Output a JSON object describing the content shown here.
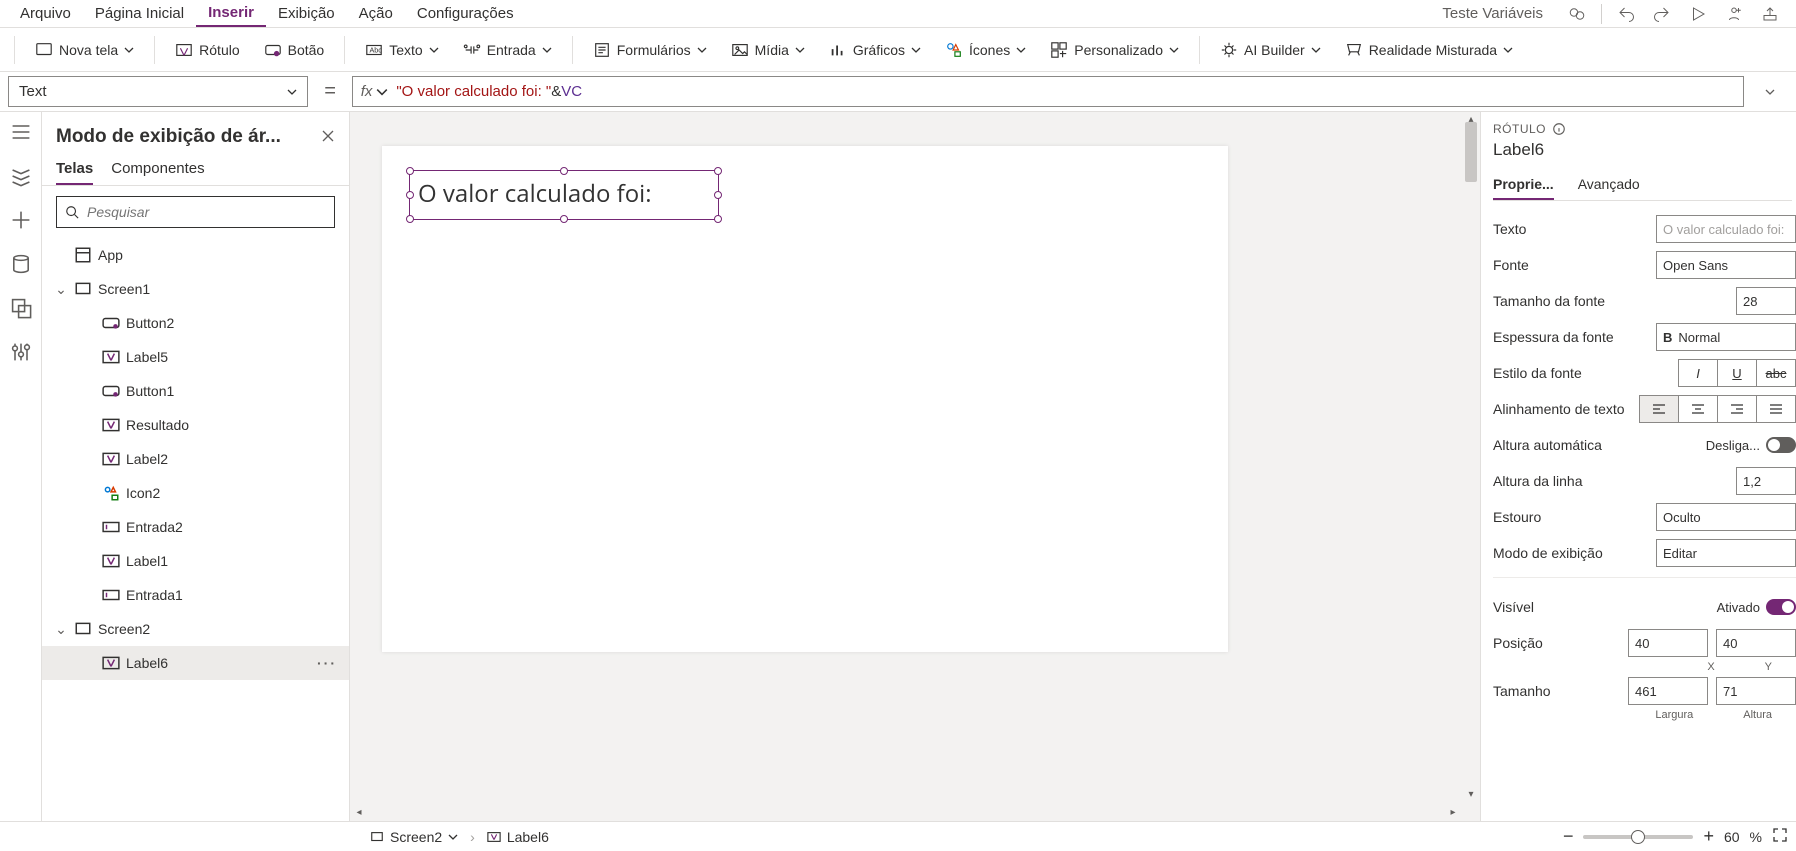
{
  "menubar": {
    "items": [
      "Arquivo",
      "Página Inicial",
      "Inserir",
      "Exibição",
      "Ação",
      "Configurações"
    ],
    "active_index": 2,
    "app_title": "Teste Variáveis"
  },
  "ribbon": {
    "nova_tela": "Nova tela",
    "rotulo": "Rótulo",
    "botao": "Botão",
    "texto": "Texto",
    "entrada": "Entrada",
    "formularios": "Formulários",
    "midia": "Mídia",
    "graficos": "Gráficos",
    "icones": "Ícones",
    "personalizado": "Personalizado",
    "ai_builder": "AI Builder",
    "realidade": "Realidade Misturada"
  },
  "formula": {
    "property": "Text",
    "fx_string": "\"O valor calculado foi: \"",
    "fx_op": "&",
    "fx_var": "VC"
  },
  "tree": {
    "title": "Modo de exibição de ár...",
    "tab_telas": "Telas",
    "tab_componentes": "Componentes",
    "search_placeholder": "Pesquisar",
    "app": "App",
    "screen1": "Screen1",
    "button2": "Button2",
    "label5": "Label5",
    "button1": "Button1",
    "resultado": "Resultado",
    "label2": "Label2",
    "icon2": "Icon2",
    "entrada2": "Entrada2",
    "label1": "Label1",
    "entrada1": "Entrada1",
    "screen2": "Screen2",
    "label6": "Label6"
  },
  "canvas": {
    "label_text": "O valor calculado foi:"
  },
  "properties": {
    "type": "RÓTULO",
    "name": "Label6",
    "tab_propriedades": "Proprie...",
    "tab_avancado": "Avançado",
    "texto_label": "Texto",
    "texto_value": "O valor calculado foi:",
    "fonte_label": "Fonte",
    "fonte_value": "Open Sans",
    "tamanho_fonte_label": "Tamanho da fonte",
    "tamanho_fonte_value": "28",
    "espessura_label": "Espessura da fonte",
    "espessura_value": "Normal",
    "estilo_label": "Estilo da fonte",
    "alinhamento_label": "Alinhamento de texto",
    "altura_auto_label": "Altura automática",
    "altura_auto_value": "Desliga...",
    "altura_linha_label": "Altura da linha",
    "altura_linha_value": "1,2",
    "estouro_label": "Estouro",
    "estouro_value": "Oculto",
    "modo_exibicao_label": "Modo de exibição",
    "modo_exibicao_value": "Editar",
    "visivel_label": "Visível",
    "visivel_value": "Ativado",
    "posicao_label": "Posição",
    "pos_x": "40",
    "pos_y": "40",
    "pos_x_label": "X",
    "pos_y_label": "Y",
    "tamanho_label": "Tamanho",
    "largura": "461",
    "altura": "71",
    "largura_label": "Largura",
    "altura_label": "Altura"
  },
  "bottom": {
    "screen": "Screen2",
    "label": "Label6",
    "zoom": "60",
    "pct": "%"
  }
}
